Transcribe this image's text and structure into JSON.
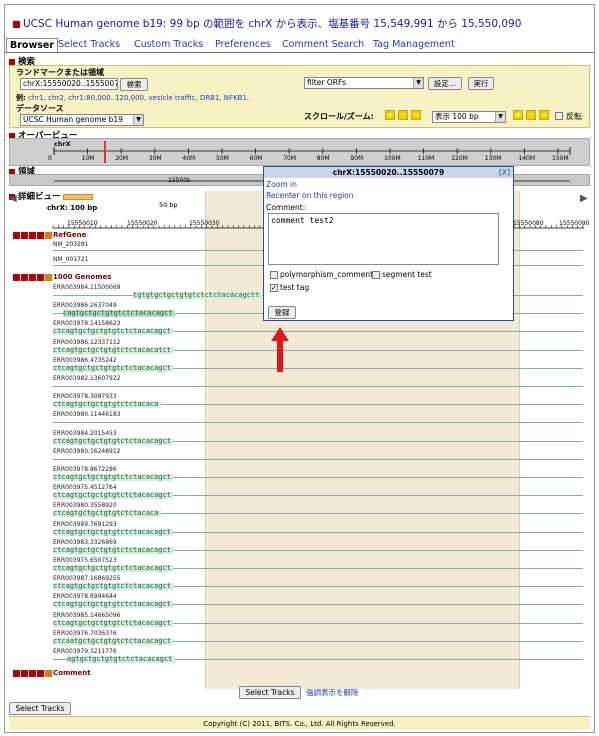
{
  "title": "UCSC Human genome b19: 99 bp の範囲を chrX から表示、塩基番号 15,549,991 から 15,550,090",
  "tabs": [
    "Browser",
    "Select Tracks",
    "Custom Tracks",
    "Preferences",
    "Comment Search",
    "Tag Management"
  ],
  "search": {
    "header": "検索",
    "landmark_label": "ランドマークまたは領域",
    "landmark_value": "chrX:15550020..1555007",
    "search_btn": "検索",
    "example_label": "例:",
    "examples": "chr1, chr2, chr1:80,000..120,000, vesicle traffic, DRB1, NFKB1.",
    "datasource_label": "データソース",
    "datasource_value": "UCSC Human genome b19",
    "filter_value": "filter ORFs",
    "settings_btn": "設定...",
    "run_btn": "実行",
    "scroll_label": "スクロール/ズーム:",
    "zoom_value": "表示 100 bp",
    "flip_label": "反転"
  },
  "overview": {
    "header": "オーバービュー",
    "chrom": "chrX",
    "ticks": [
      "0",
      "10M",
      "20M",
      "30M",
      "40M",
      "50M",
      "60M",
      "70M",
      "80M",
      "90M",
      "100M",
      "110M",
      "120M",
      "130M",
      "140M",
      "150M"
    ]
  },
  "region": {
    "header": "領域",
    "label": "15500k"
  },
  "detail": {
    "header": "詳細ビュー",
    "chrom_label": "chrX: 100 bp",
    "scale_label": "50 bp",
    "ticks": [
      "15550010",
      "15550020",
      "15550030",
      "15550080",
      "15550090"
    ]
  },
  "tracks": {
    "refgene": "RefGene",
    "refgene_rows": [
      "NM_203281",
      "NM_001721"
    ],
    "genomes": "1000 Genomes",
    "comment": "Comment"
  },
  "reads": [
    {
      "name": "ERR003984.11500069",
      "seq": "tgtgtgctgctgtgtctctctacacagctt",
      "x": 80
    },
    {
      "name": "ERR003986.2637049",
      "seq": "cagtgctgctgtgtctctacacagct",
      "x": 10,
      "dk": true
    },
    {
      "name": "ERR003978.14158623",
      "seq": "ctcagtgctgctgtgtctctacacagct",
      "x": 0
    },
    {
      "name": "ERR003986.12337112",
      "seq": "ctcagtgctgctgtgtctctacacatct",
      "x": 0
    },
    {
      "name": "ERR003986.4735242",
      "seq": "ctcagtgctgctgtgtctctacacagct",
      "x": 0
    },
    {
      "name": "ERR003982.13607922",
      "seq": "",
      "x": 0
    },
    {
      "name": "ERR003978.3087933",
      "seq": "ctcagtgctgctgtgtctctacaca",
      "x": 0
    },
    {
      "name": "ERR003980.11446183",
      "seq": "",
      "x": 0
    },
    {
      "name": "ERR003984.2015453",
      "seq": "ctcagtgctgctgtgtctctacacagct",
      "x": 0
    },
    {
      "name": "ERR003980.16248912",
      "seq": "",
      "x": 0
    },
    {
      "name": "ERR003978.8672286",
      "seq": "ctcagtgctgctgtgtctctacacagct",
      "x": 0
    },
    {
      "name": "ERR003975.4512764",
      "seq": "ctcagtgctgctgtgtctctacacagct",
      "x": 0
    },
    {
      "name": "ERR003980.3558920",
      "seq": "ctcagtgctgctgtgtctctacaca",
      "x": 0
    },
    {
      "name": "ERR003989.7691293",
      "seq": "ctcagtgctgctgtgtctctacacagct",
      "x": 0
    },
    {
      "name": "ERR003983.3326869",
      "seq": "ctcagtgctgctgtgtctctacacagct",
      "x": 0
    },
    {
      "name": "ERR003975.6507523",
      "seq": "ctcagtgctgctgtgtctctacacagct",
      "x": 0
    },
    {
      "name": "ERR003987.16869255",
      "seq": "ctcagtgctgctgtgtctctacacagct",
      "x": 0
    },
    {
      "name": "ERR003978.6994644",
      "seq": "ctcagtgctgctgtgtctctacacagct",
      "x": 0
    },
    {
      "name": "ERR003985.14665096",
      "seq": "ctcagtgctgctgtgtctctacacagct",
      "x": 0
    },
    {
      "name": "ERR003976.7036376",
      "seq": "ctcaatgctgctgtgtctctacacagct",
      "x": 0
    },
    {
      "name": "ERR003979.3211776",
      "seq": "agtgctgctgtgtctctacacagct",
      "x": 14
    }
  ],
  "popup": {
    "title": "chrX:15550020..15550079",
    "close": "[X]",
    "zoom": "Zoom in",
    "recenter": "Recenter on this region",
    "comment_label": "Comment:",
    "comment_text": "comment test2",
    "tags": [
      "polymorphism_comment",
      "segment test",
      "test tag"
    ],
    "submit": "登録"
  },
  "bottom": {
    "select_tracks_btn": "Select Tracks",
    "clear_highlight": "強調表示を解除",
    "left_btn": "Select Tracks"
  },
  "footer": "Copyright (C) 2011, BITS. Co., Ltd. All Rights Reserved.",
  "colors": {
    "accent": "#1d3fb8",
    "panel": "#f7f1c4",
    "highlight": "#f3e9d6",
    "read": "#d6ecdc"
  }
}
